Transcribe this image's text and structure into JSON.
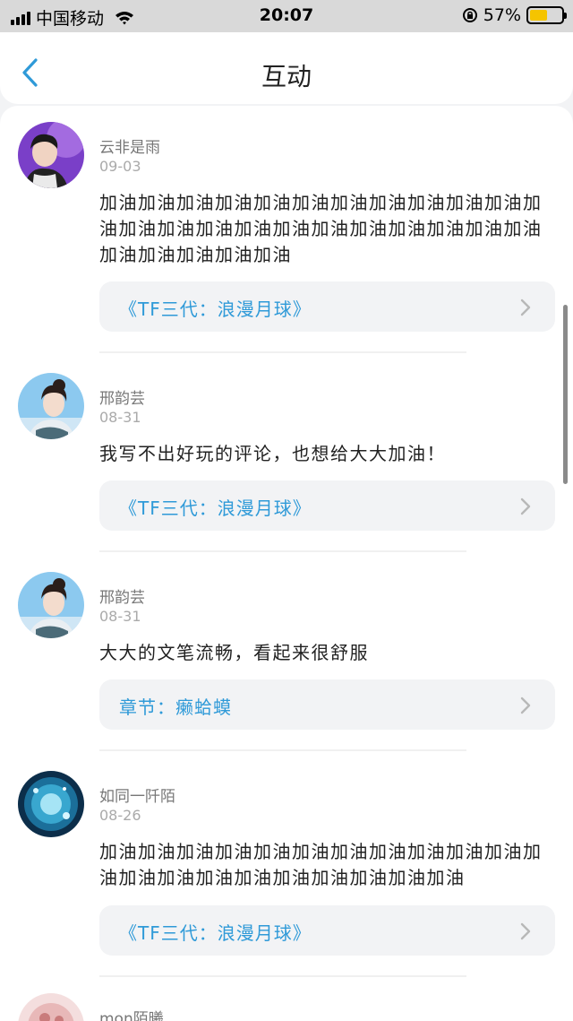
{
  "status_bar": {
    "carrier": "中国移动",
    "time": "20:07",
    "battery_percent": "57%",
    "battery_level": 0.57,
    "battery_color": "#f5c400",
    "icons": [
      "signal-icon",
      "wifi-icon",
      "rotation-lock-icon",
      "battery-icon"
    ]
  },
  "nav": {
    "title": "互动",
    "back_icon": "chevron-left-icon",
    "accent": "#2f9ad8"
  },
  "comments": [
    {
      "user": "云非是雨",
      "date": "09-03",
      "text": "加油加油加油加油加油加油加油加油加油加油加油加油加油加油加油加油加油加油加油加油加油加油加油加油加油加油加油加油",
      "link": "《TF三代：浪漫月球》"
    },
    {
      "user": "邢韵芸",
      "date": "08-31",
      "text": "我写不出好玩的评论，也想给大大加油！",
      "link": "《TF三代：浪漫月球》"
    },
    {
      "user": "邢韵芸",
      "date": "08-31",
      "text": "大大的文笔流畅，看起来很舒服",
      "link": "章节：癞蛤蟆"
    },
    {
      "user": "如同一阡陌",
      "date": "08-26",
      "text": "加油加油加油加油加油加油加油加油加油加油加油加油加油加油加油加油加油加油加油加油加油",
      "link": "《TF三代：浪漫月球》"
    },
    {
      "user": "mon陌曦",
      "date": "",
      "text": "",
      "link": ""
    }
  ]
}
